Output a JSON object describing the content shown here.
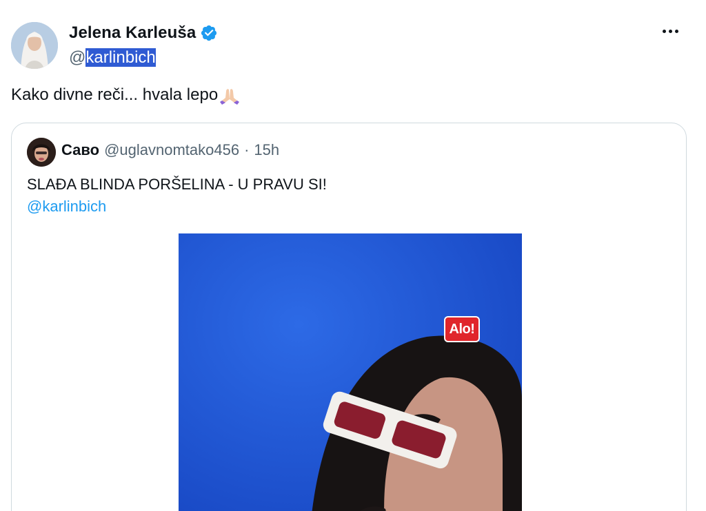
{
  "author": {
    "display_name": "Jelena Karleuša",
    "handle_prefix": "@",
    "handle_selected": "karlinbich",
    "verified": true,
    "verified_icon": "verified-badge-icon",
    "avatar_icon": "user-avatar"
  },
  "more_icon": "more-options-icon",
  "tweet": {
    "text": "Kako divne reči... hvala lepo",
    "emoji": "🙏🏻"
  },
  "quote": {
    "author_name": "Саво",
    "author_handle": "@uglavnomtako456",
    "separator": "·",
    "time": "15h",
    "text": "SLAĐA BLINDA PORŠELINA - U PRAVU SI!",
    "mention": "@karlinbich",
    "media": {
      "type": "video-thumbnail",
      "badge_text": "Alo!"
    }
  },
  "colors": {
    "text_primary": "#0f1419",
    "text_secondary": "#536471",
    "link": "#1d9bf0",
    "verified": "#1d9bf0",
    "selection": "#2f5bd3",
    "card_border": "#cfd9de",
    "media_background": "#1f55d6",
    "badge_red": "#e0262b"
  }
}
